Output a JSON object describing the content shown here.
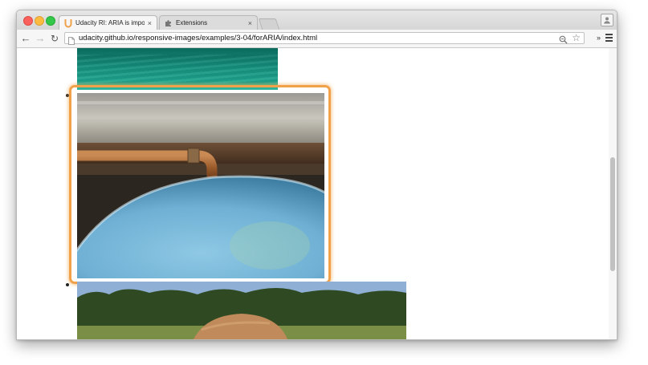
{
  "browser": {
    "tabs": [
      {
        "title": "Udacity RI: ARIA is importa",
        "close": "×",
        "favicon": "udacity-logo-icon",
        "active": true
      },
      {
        "title": "Extensions",
        "close": "×",
        "favicon": "puzzle-piece-icon",
        "active": false
      }
    ],
    "url": "udacity.github.io/responsive-images/examples/3-04/forARIA/index.html",
    "nav": {
      "back": "←",
      "forward": "→",
      "reload": "↻"
    },
    "star": "☆",
    "overflow": "»"
  },
  "page": {
    "images": [
      {
        "name": "water-photo",
        "description_visible": false
      },
      {
        "name": "water-heater-tank-photo",
        "focused": true
      },
      {
        "name": "field-rock-photo"
      }
    ]
  },
  "colors": {
    "focus_ring": "#f0a14a",
    "udacity_brand": "#f0a14a"
  }
}
